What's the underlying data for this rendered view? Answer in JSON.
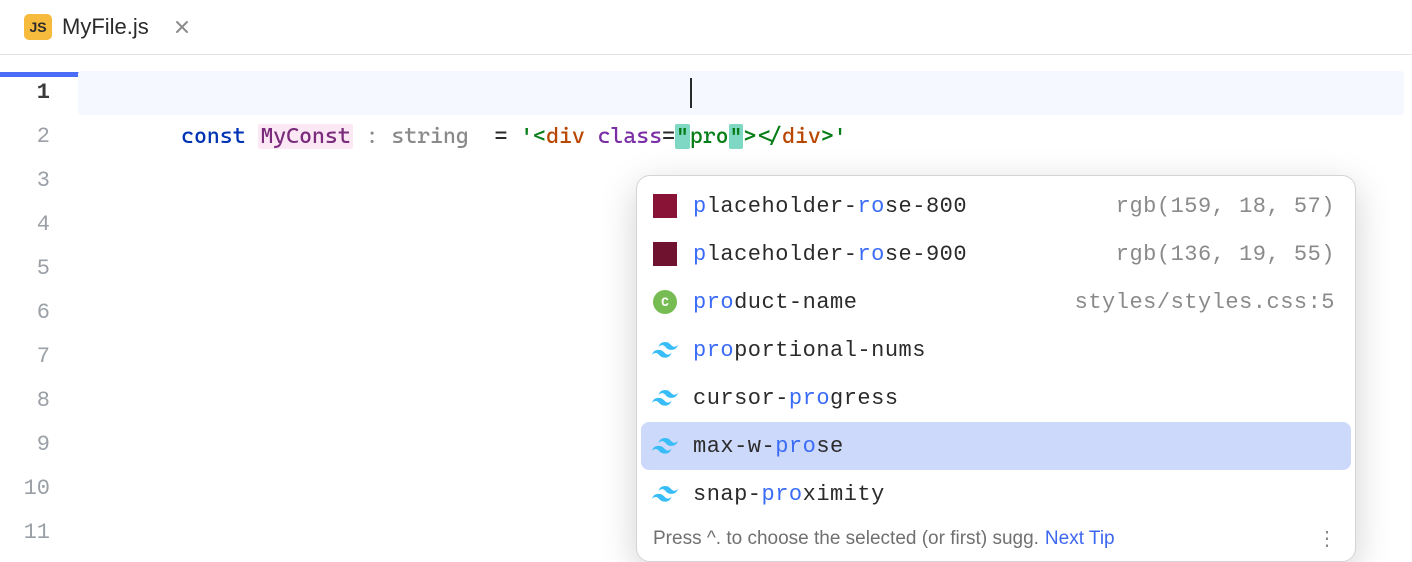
{
  "tab": {
    "icon_text": "JS",
    "filename": "MyFile.js"
  },
  "editor": {
    "line_count": 11,
    "active_line": 1,
    "code": {
      "keyword": "const",
      "identifier": "MyConst",
      "type_annotation": ": string",
      "equals": "=",
      "open_q": "'",
      "lt1": "<",
      "tag1": "div",
      "space1": " ",
      "attr": "class",
      "eq": "=",
      "q1": "\"",
      "typed": "pro",
      "q2": "\"",
      "gt1": ">",
      "lt2": "</",
      "tag2": "div",
      "gt2": ">",
      "close_q": "'"
    }
  },
  "popup": {
    "items": [
      {
        "icon": "swatch",
        "swatch_color": "#881337",
        "segments": [
          "p",
          "laceholder-",
          "ro",
          "se-800"
        ],
        "right": "rgb(159, 18, 57)"
      },
      {
        "icon": "swatch",
        "swatch_color": "#6f1230",
        "segments": [
          "p",
          "laceholder-",
          "ro",
          "se-900"
        ],
        "right": "rgb(136, 19, 55)"
      },
      {
        "icon": "css",
        "segments": [
          "pro",
          "duct-name"
        ],
        "right": "styles/styles.css:5"
      },
      {
        "icon": "tailwind",
        "segments": [
          "pro",
          "portional-nums"
        ],
        "right": ""
      },
      {
        "icon": "tailwind",
        "segments": [
          "",
          "cursor-",
          "pro",
          "gress"
        ],
        "right": ""
      },
      {
        "icon": "tailwind",
        "segments": [
          "",
          "max-w-",
          "pro",
          "se"
        ],
        "right": "",
        "selected": true
      },
      {
        "icon": "tailwind",
        "segments": [
          "",
          "snap-",
          "pro",
          "ximity"
        ],
        "right": ""
      }
    ],
    "footer_text": "Press ^. to choose the selected (or first) sugg.",
    "footer_link": "Next Tip",
    "css_circle_letter": "C"
  }
}
